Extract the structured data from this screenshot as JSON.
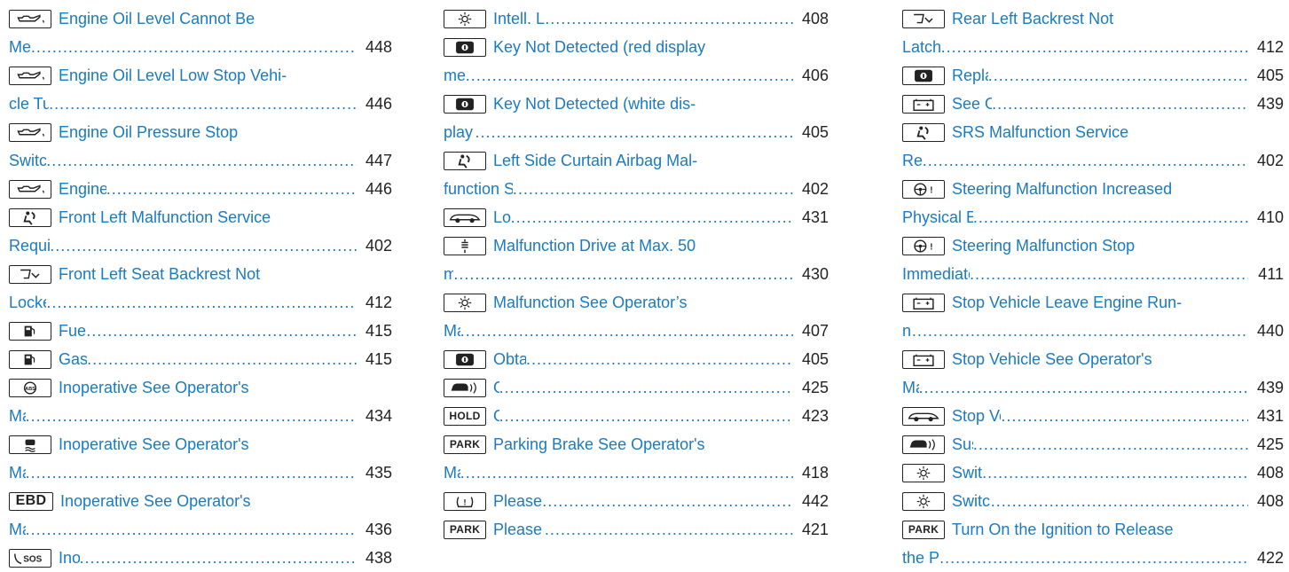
{
  "columns": [
    [
      {
        "icon": "oil-can-icon",
        "lines": [
          "Engine Oil Level Cannot Be",
          "Measured"
        ],
        "page": "448"
      },
      {
        "icon": "oil-can-icon",
        "lines": [
          "Engine Oil Level Low Stop Vehi-",
          "cle Turn Engine Off"
        ],
        "page": "446"
      },
      {
        "icon": "oil-can-icon",
        "lines": [
          "Engine Oil Pressure Stop",
          "Switch Off Engine"
        ],
        "page": "447"
      },
      {
        "icon": "oil-can-icon",
        "lines": [
          "Engine Oil Reduce Oil Level"
        ],
        "page": "446"
      },
      {
        "icon": "airbag-icon",
        "lines": [
          "Front Left Malfunction Service",
          "Required (example)"
        ],
        "page": "402"
      },
      {
        "icon": "seat-backrest-icon",
        "lines": [
          "Front Left Seat Backrest Not",
          "Locked (example)"
        ],
        "page": "412"
      },
      {
        "icon": "fuel-pump-icon",
        "lines": [
          "Fuel Level Low"
        ],
        "page": "415"
      },
      {
        "icon": "fuel-pump-icon",
        "lines": [
          "Gas Cap Loose"
        ],
        "page": "415"
      },
      {
        "icon": "abs-icon",
        "lines": [
          "Inoperative See Operator's",
          "Manual"
        ],
        "page": "434"
      },
      {
        "icon": "esp-icon",
        "lines": [
          "Inoperative See Operator's",
          "Manual"
        ],
        "page": "435"
      },
      {
        "icon": "ebd-icon",
        "icon_text": "EBD",
        "lines": [
          "Inoperative See Operator's",
          "Manual"
        ],
        "page": "436"
      },
      {
        "icon": "sos-icon",
        "icon_text": "SOS",
        "lines": [
          "Inoperative"
        ],
        "page": "438"
      }
    ],
    [
      {
        "icon": "light-bulb-icon",
        "lines": [
          "Intell. Light System Inoperative"
        ],
        "page": "408"
      },
      {
        "icon": "key-icon",
        "lines": [
          "Key Not Detected (red display",
          "message)"
        ],
        "page": "406"
      },
      {
        "icon": "key-icon",
        "lines": [
          "Key Not Detected (white dis-",
          "play message)"
        ],
        "page": "405"
      },
      {
        "icon": "airbag-icon",
        "lines": [
          "Left Side Curtain Airbag Mal-",
          "function Service Required (example)"
        ],
        "page": "402"
      },
      {
        "icon": "car-lowering-icon",
        "lines": [
          "Lowering"
        ],
        "page": "431"
      },
      {
        "icon": "suspension-icon",
        "lines": [
          "Malfunction Drive at Max. 50",
          "mph"
        ],
        "page": "430"
      },
      {
        "icon": "light-bulb-icon",
        "lines": [
          "Malfunction See Operator’s",
          "Manual"
        ],
        "page": "407"
      },
      {
        "icon": "key-icon",
        "lines": [
          "Obtain a New Key"
        ],
        "page": "405"
      },
      {
        "icon": "distance-assist-icon",
        "lines": [
          "Off"
        ],
        "page": "425"
      },
      {
        "icon": "hold-icon",
        "icon_text": "HOLD",
        "lines": [
          "Off"
        ],
        "page": "423"
      },
      {
        "icon": "park-icon",
        "icon_text": "PARK",
        "lines": [
          "Parking Brake See Operator's",
          "Manual"
        ],
        "page": "418"
      },
      {
        "icon": "tire-pressure-icon",
        "lines": [
          "Please Correct Tire Pressure"
        ],
        "page": "442"
      },
      {
        "icon": "park-icon",
        "icon_text": "PARK",
        "lines": [
          "Please Release Parking Brake"
        ],
        "page": "421"
      }
    ],
    [
      {
        "icon": "seat-backrest-icon",
        "lines": [
          "Rear Left Backrest Not",
          "Latched (example)"
        ],
        "page": "412"
      },
      {
        "icon": "key-icon",
        "lines": [
          "Replace Key Battery"
        ],
        "page": "405"
      },
      {
        "icon": "battery-icon",
        "lines": [
          "See Operator's Manual"
        ],
        "page": "439"
      },
      {
        "icon": "airbag-icon",
        "lines": [
          "SRS Malfunction Service",
          "Required"
        ],
        "page": "402"
      },
      {
        "icon": "steering-wheel-icon",
        "lines": [
          "Steering Malfunction Increased",
          "Physical Effort See Operator's Manual"
        ],
        "page": "410"
      },
      {
        "icon": "steering-wheel-icon",
        "lines": [
          "Steering Malfunction Stop",
          "Immediately See Operator's Manual"
        ],
        "page": "411"
      },
      {
        "icon": "battery-icon",
        "lines": [
          "Stop Vehicle Leave Engine Run-",
          "ning"
        ],
        "page": "440"
      },
      {
        "icon": "battery-icon",
        "lines": [
          "Stop Vehicle See Operator's",
          "Manual"
        ],
        "page": "439"
      },
      {
        "icon": "car-lowering-icon",
        "lines": [
          "Stop Vehicle Vehicle Too Low"
        ],
        "page": "431"
      },
      {
        "icon": "distance-assist-icon",
        "lines": [
          "Suspended"
        ],
        "page": "425"
      },
      {
        "icon": "light-bulb-icon",
        "lines": [
          "Switch Off Lights"
        ],
        "page": "408"
      },
      {
        "icon": "light-bulb-icon",
        "lines": [
          "Switch On Headlamps"
        ],
        "page": "408"
      },
      {
        "icon": "park-icon",
        "icon_text": "PARK",
        "lines": [
          "Turn On the Ignition to Release",
          "the Parking Brake"
        ],
        "page": "422"
      }
    ]
  ]
}
